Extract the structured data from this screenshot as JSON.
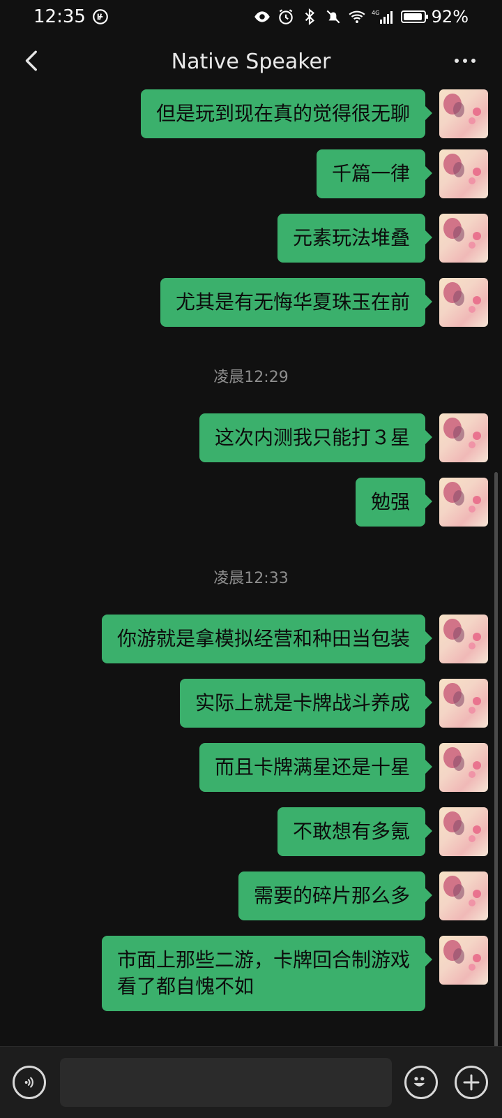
{
  "status_bar": {
    "time": "12:35",
    "network": "4G",
    "battery": "92%",
    "battery_level": 0.92
  },
  "header": {
    "title": "Native Speaker"
  },
  "messages": [
    {
      "text": "但是玩到现在真的觉得很无聊"
    },
    {
      "text": "千篇一律"
    },
    {
      "text": "元素玩法堆叠"
    },
    {
      "text": "尤其是有无悔华夏珠玉在前"
    },
    {
      "timestamp": "凌晨12:29"
    },
    {
      "text": "这次内测我只能打３星"
    },
    {
      "text": "勉强"
    },
    {
      "timestamp": "凌晨12:33"
    },
    {
      "text": "你游就是拿模拟经营和种田当包装"
    },
    {
      "text": "实际上就是卡牌战斗养成"
    },
    {
      "text": "而且卡牌满星还是十星"
    },
    {
      "text": "不敢想有多氪"
    },
    {
      "text": "需要的碎片那么多"
    },
    {
      "text": "市面上那些二游，卡牌回合制游戏\n看了都自愧不如"
    }
  ],
  "input": {
    "value": "",
    "placeholder": ""
  },
  "colors": {
    "bubble": "#3bb06c",
    "background": "#111111",
    "input_bar": "#1d1d1d"
  }
}
